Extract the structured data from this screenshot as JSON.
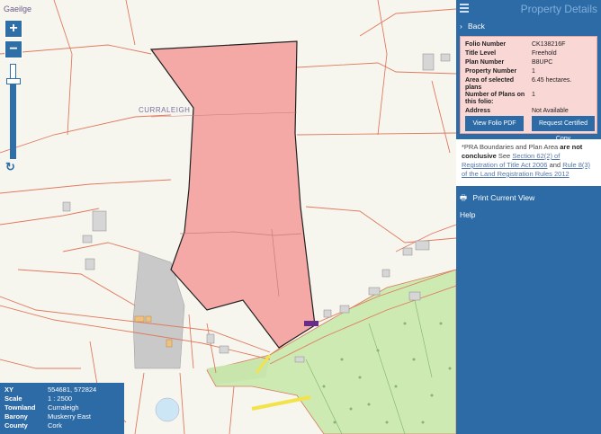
{
  "map": {
    "language_link": "Gaeilge",
    "zoom_in": "+",
    "zoom_out": "−",
    "zoom_level": 0.18,
    "townland_label": "CURRALEIGH",
    "info": [
      {
        "k": "XY",
        "v": "554681, 572824"
      },
      {
        "k": "Scale",
        "v": "1 : 2500"
      },
      {
        "k": "Townland",
        "v": "Curraleigh"
      },
      {
        "k": "Barony",
        "v": "Muskerry East"
      },
      {
        "k": "County",
        "v": "Cork"
      }
    ]
  },
  "panel": {
    "title": "Property Details",
    "back": "Back",
    "fields": [
      {
        "k": "Folio Number",
        "v": "CK138216F"
      },
      {
        "k": "Title Level",
        "v": "Freehold"
      },
      {
        "k": "Plan Number",
        "v": "B8UPC"
      },
      {
        "k": "Property Number",
        "v": "1"
      },
      {
        "k": "Area of selected plans",
        "v": "6.45 hectares."
      },
      {
        "k": "Number of Plans on this folio:",
        "v": "1"
      },
      {
        "k": "Address",
        "v": "Not Available"
      }
    ],
    "view_folio": "View Folio PDF",
    "request_copy": "Request Certified Copy",
    "notice": {
      "prefix": "*PRA Boundaries and Plan Area",
      "bold": "are not conclusive",
      "see": "See",
      "link1": "Section 62(2) of Registration of Title Act 2006",
      "and": "and",
      "link2": "Rule 8(3) of the Land Registration Rules 2012"
    },
    "print": "Print Current View",
    "help": "Help"
  },
  "colors": {
    "accent": "#2d6ba6",
    "parcel_fill": "#f4a9a6",
    "boundary": "#e07a5f",
    "road_fill": "#cdeab3"
  }
}
